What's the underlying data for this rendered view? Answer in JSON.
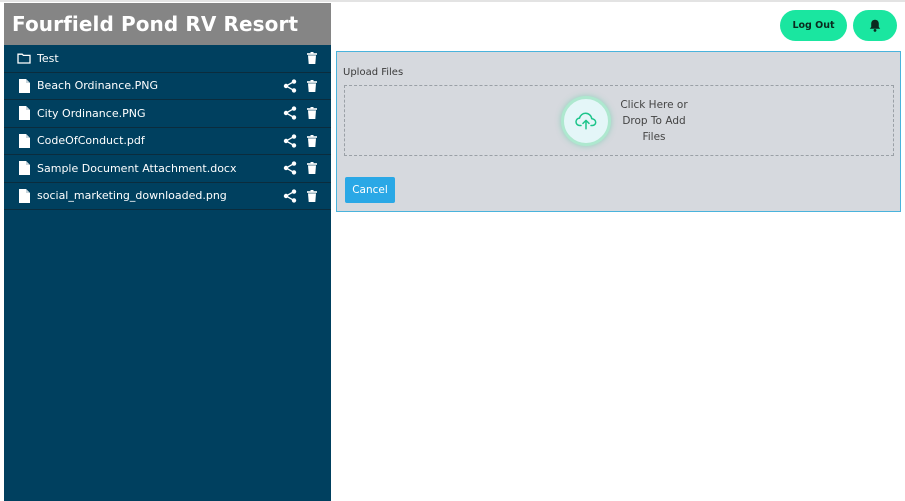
{
  "app": {
    "title": "Fourfield Pond RV Resort"
  },
  "header": {
    "logout_label": "Log Out",
    "bell_icon": "bell-icon"
  },
  "sidebar": {
    "items": [
      {
        "type": "folder",
        "name": "Test",
        "icon": "folder-icon",
        "shareable": false
      },
      {
        "type": "file",
        "name": "Beach Ordinance.PNG",
        "icon": "file-icon",
        "shareable": true
      },
      {
        "type": "file",
        "name": "City Ordinance.PNG",
        "icon": "file-icon",
        "shareable": true
      },
      {
        "type": "file",
        "name": "CodeOfConduct.pdf",
        "icon": "file-icon",
        "shareable": true
      },
      {
        "type": "file",
        "name": "Sample Document Attachment.docx",
        "icon": "file-icon",
        "shareable": true
      },
      {
        "type": "file",
        "name": "social_marketing_downloaded.png",
        "icon": "file-icon",
        "shareable": true
      }
    ]
  },
  "upload": {
    "label": "Upload Files",
    "drop_line1": "Click Here or",
    "drop_line2": "Drop To Add",
    "drop_line3": "Files",
    "upload_icon": "cloud-upload-icon",
    "cancel_label": "Cancel"
  },
  "colors": {
    "sidebar_bg": "#00405f",
    "brand_bg": "#858585",
    "accent_green": "#1ae6a0",
    "panel_bg": "#d6d9de",
    "panel_border": "#4ab3dc",
    "cancel_blue": "#2aa8e6"
  }
}
